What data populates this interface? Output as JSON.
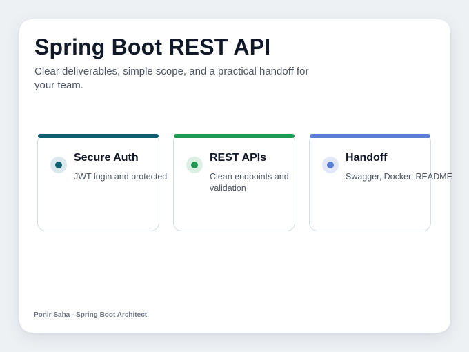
{
  "header": {
    "title": "Spring Boot REST API",
    "subtitle": "Clear deliverables, simple scope, and a practical handoff for your team."
  },
  "features": [
    {
      "title": "Secure Auth",
      "description": "JWT login and protected",
      "accent": "#0f5f73",
      "icon": "dot-icon"
    },
    {
      "title": "REST APIs",
      "description": "Clean endpoints and validation",
      "accent": "#1f9a55",
      "icon": "dot-icon"
    },
    {
      "title": "Handoff",
      "description": "Swagger, Docker, README",
      "accent": "#5b7fd6",
      "icon": "dot-icon"
    }
  ],
  "footer": {
    "author": "Ponir Saha - Spring Boot Architect"
  }
}
